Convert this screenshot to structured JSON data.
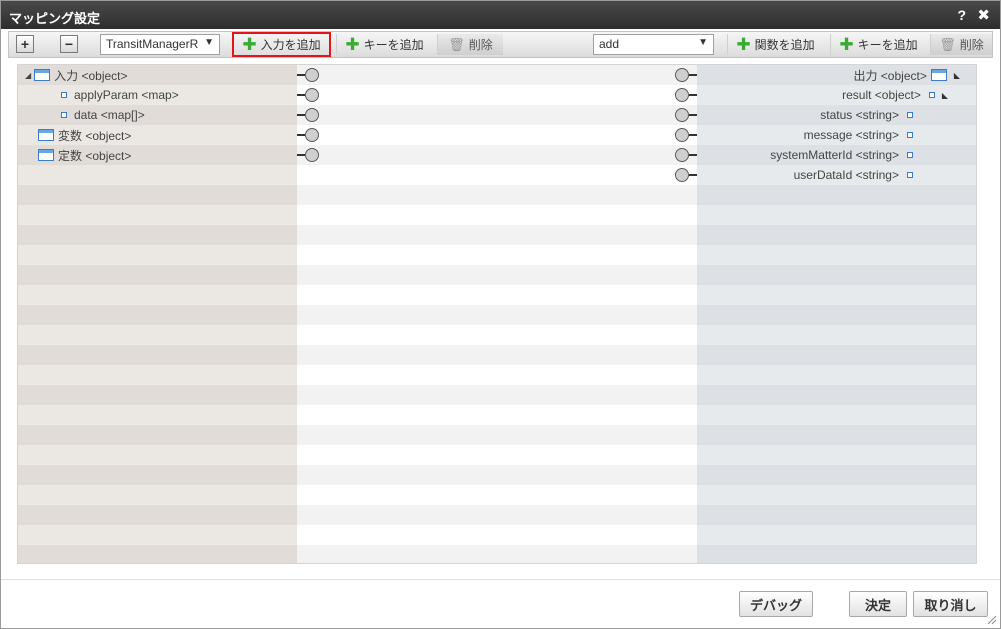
{
  "window": {
    "title": "マッピング設定",
    "help_label": "?",
    "close_label": "✖"
  },
  "toolbar": {
    "expand_label": "+",
    "collapse_label": "−",
    "input_select_value": "TransitManagerR",
    "add_input_label": "入力を追加",
    "add_key_left_label": "キーを追加",
    "delete_left_label": "削除",
    "output_select_value": "add",
    "add_function_label": "関数を追加",
    "add_key_right_label": "キーを追加",
    "delete_right_label": "削除"
  },
  "input_tree": [
    {
      "label": "入力 <object>",
      "indent": 0,
      "type": "object",
      "expanded": true
    },
    {
      "label": "applyParam <map>",
      "indent": 1,
      "type": "leaf"
    },
    {
      "label": "data <map[]>",
      "indent": 1,
      "type": "leaf"
    },
    {
      "label": "変数 <object>",
      "indent": 0,
      "type": "object"
    },
    {
      "label": "定数 <object>",
      "indent": 0,
      "type": "object"
    }
  ],
  "output_tree": [
    {
      "label": "出力 <object>",
      "type": "object"
    },
    {
      "label": "result <object>",
      "type": "leaf"
    },
    {
      "label": "status <string>",
      "type": "leaf"
    },
    {
      "label": "message <string>",
      "type": "leaf"
    },
    {
      "label": "systemMatterId <string>",
      "type": "leaf"
    },
    {
      "label": "userDataId <string>",
      "type": "leaf"
    }
  ],
  "footer": {
    "debug_label": "デバッグ",
    "ok_label": "決定",
    "cancel_label": "取り消し"
  },
  "colors": {
    "titlebar": "#3a3a3a",
    "highlight": "#e0161b",
    "plus_icon": "#3aaa35",
    "object_icon": "#3a7cc7"
  }
}
